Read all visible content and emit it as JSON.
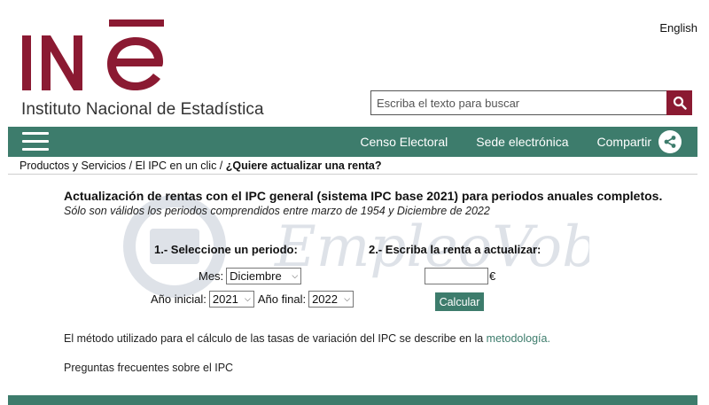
{
  "header": {
    "language_link": "English",
    "logo_text": "INE",
    "institute_name": "Instituto Nacional de Estadística",
    "search_placeholder": "Escriba el texto para buscar"
  },
  "nav": {
    "links": [
      "Censo Electoral",
      "Sede electrónica",
      "Compartir"
    ]
  },
  "breadcrumb": {
    "items": [
      "Productos y Servicios",
      "El IPC en un clic"
    ],
    "separator": " / ",
    "current": "¿Quiere actualizar una renta?"
  },
  "main": {
    "title": "Actualización de rentas con el IPC general (sistema IPC base 2021) para periodos anuales completos.",
    "subtitle": "Sólo son válidos los periodos comprendidos entre marzo de 1954 y Diciembre de 2022",
    "step1_label": "1.-  Seleccione un periodo:",
    "step2_label": "2.-  Escriba la renta a actualizar:",
    "month_label": "Mes:",
    "month_value": "Diciembre",
    "start_year_label": "Año inicial:",
    "start_year_value": "2021",
    "end_year_label": "Año final:",
    "end_year_value": "2022",
    "currency_symbol": "€",
    "calculate_label": "Calcular",
    "method_text": "El método utilizado para el cálculo de las tasas de variación del IPC se describe en la",
    "method_link": "metodología.",
    "faq_text": "Preguntas frecuentes sobre el IPC"
  },
  "watermark": {
    "text": "EmpleoVob.es"
  },
  "colors": {
    "brand_red": "#8b1a32",
    "brand_green": "#3d7c6c"
  },
  "icons": {
    "search": "search-icon",
    "menu": "hamburger-menu-icon",
    "share": "share-icon",
    "chevron": "chevron-down-icon"
  }
}
